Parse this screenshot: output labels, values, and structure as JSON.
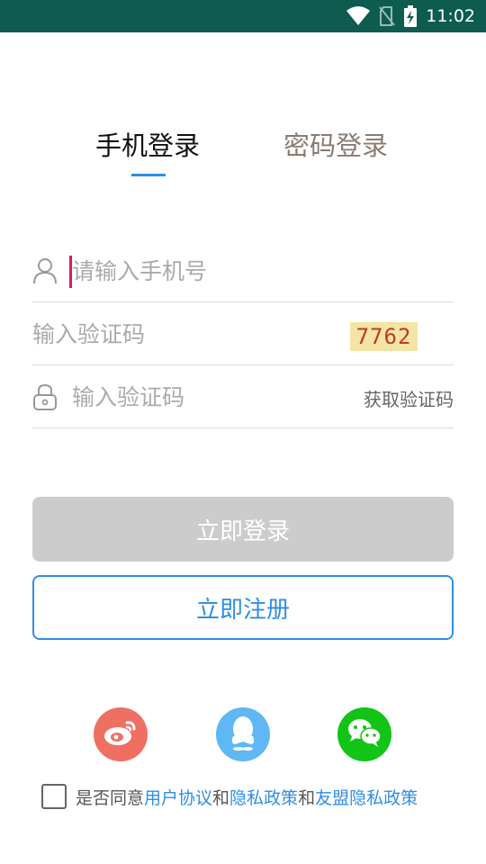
{
  "status_bar": {
    "time": "11:02",
    "icons": [
      "wifi-icon",
      "no-sim-icon",
      "battery-charging-icon"
    ]
  },
  "tabs": {
    "phone_login": "手机登录",
    "password_login": "密码登录",
    "active": "phone_login"
  },
  "form": {
    "phone": {
      "placeholder": "请输入手机号",
      "value": "",
      "icon": "user-icon"
    },
    "captcha": {
      "placeholder": "输入验证码",
      "value": "",
      "image_text": "7762"
    },
    "sms_code": {
      "placeholder": "输入验证码",
      "value": "",
      "icon": "lock-icon",
      "get_code_label": "获取验证码"
    }
  },
  "buttons": {
    "login": "立即登录",
    "register": "立即注册"
  },
  "social": [
    "weibo-icon",
    "qq-icon",
    "wechat-icon"
  ],
  "agreement": {
    "prefix": "是否同意",
    "user_agreement": "用户协议",
    "and1": "和",
    "privacy_policy": "隐私政策",
    "and2": "和",
    "umeng_privacy": "友盟隐私政策",
    "checked": false
  },
  "colors": {
    "status_bar": "#0d5c4f",
    "accent": "#2f8ee5",
    "login_disabled": "#cccccc",
    "cursor": "#d81b60",
    "weibo": "#ef6f63",
    "qq": "#5fb8f4",
    "wechat": "#12c416"
  }
}
